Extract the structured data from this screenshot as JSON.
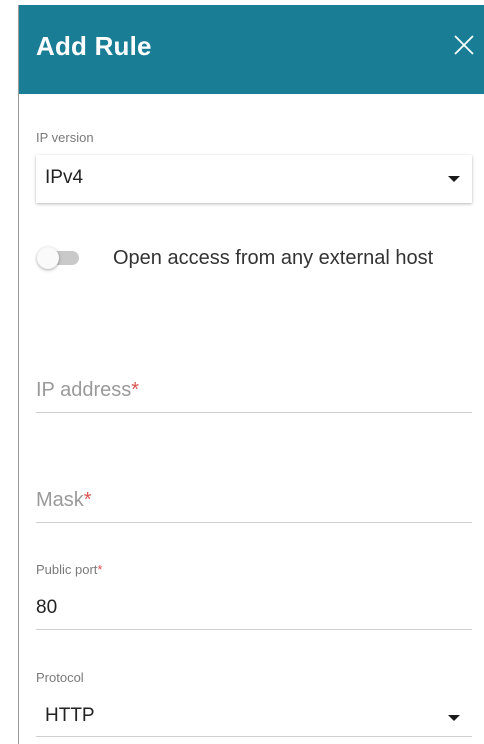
{
  "dialog": {
    "title": "Add Rule",
    "header_color": "#1a7d96"
  },
  "ip_version": {
    "label": "IP version",
    "value": "IPv4"
  },
  "open_access": {
    "label": "Open access from any external host",
    "enabled": false
  },
  "ip_address": {
    "placeholder": "IP address",
    "required_mark": "*",
    "value": ""
  },
  "mask": {
    "placeholder": "Mask",
    "required_mark": "*",
    "value": ""
  },
  "public_port": {
    "label": "Public port",
    "required_mark": "*",
    "value": "80"
  },
  "protocol": {
    "label": "Protocol",
    "value": "HTTP"
  },
  "icons": {
    "close": "close-icon",
    "dropdown": "chevron-down-icon"
  }
}
